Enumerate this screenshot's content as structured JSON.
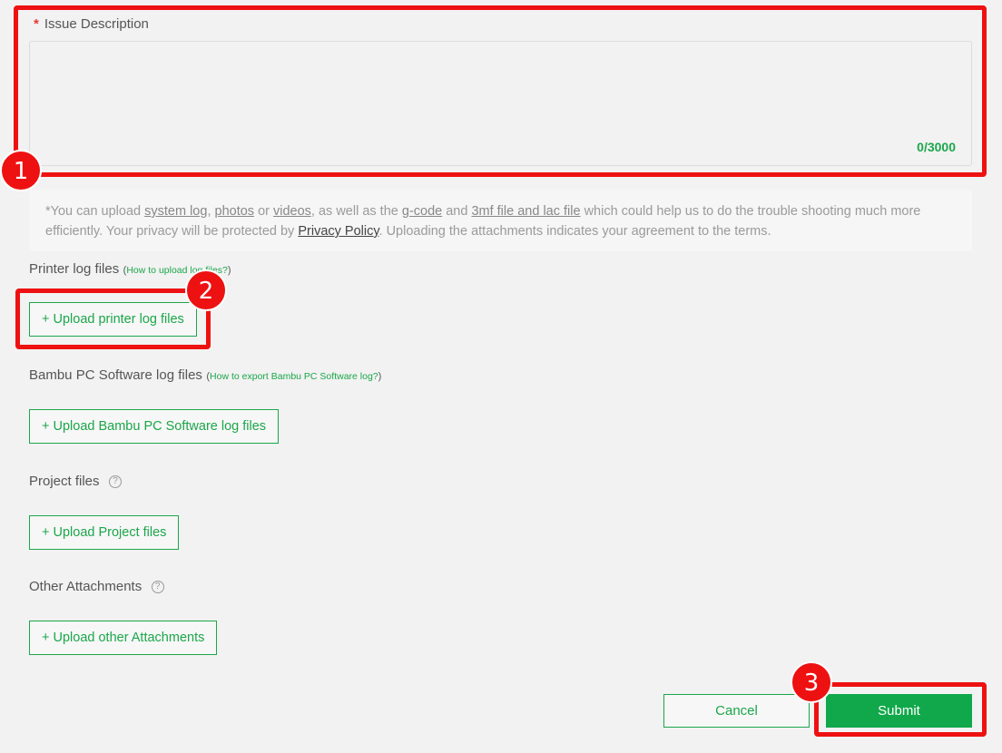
{
  "description": {
    "required_mark": "*",
    "label": "Issue Description",
    "counter": "0/3000"
  },
  "notice": {
    "p1": "*You can upload ",
    "system_log": "system log",
    "p2": ", ",
    "photos": "photos",
    "p3": " or ",
    "videos": "videos",
    "p4": ", as well as the ",
    "gcode": "g-code",
    "p5": " and ",
    "threemf": "3mf file and lac file",
    "p6": " which could help us to do the trouble shooting much more efficiently. Your privacy will be protected by ",
    "privacy": "Privacy Policy",
    "p7": ". Uploading the attachments indicates your agreement to the terms."
  },
  "sections": {
    "printer_log": {
      "label": "Printer log files",
      "open_paren": "(",
      "help": "How to upload log files?",
      "close_paren": ")",
      "button": "+ Upload printer log files"
    },
    "pc_log": {
      "label": "Bambu PC Software log files",
      "open_paren": "(",
      "help": "How to export Bambu PC Software log?",
      "close_paren": ")",
      "button": "+ Upload Bambu PC Software log files"
    },
    "project": {
      "label": "Project files",
      "help_icon": "?",
      "button": "+ Upload Project files"
    },
    "other": {
      "label": "Other Attachments",
      "help_icon": "?",
      "button": "+ Upload other Attachments"
    }
  },
  "actions": {
    "cancel": "Cancel",
    "submit": "Submit"
  },
  "annotations": [
    "1",
    "2",
    "3"
  ],
  "colors": {
    "accent": "#1ca64b",
    "submit_bg": "#10a84a",
    "annotation": "#ee1111",
    "background": "#f2f2f2"
  }
}
